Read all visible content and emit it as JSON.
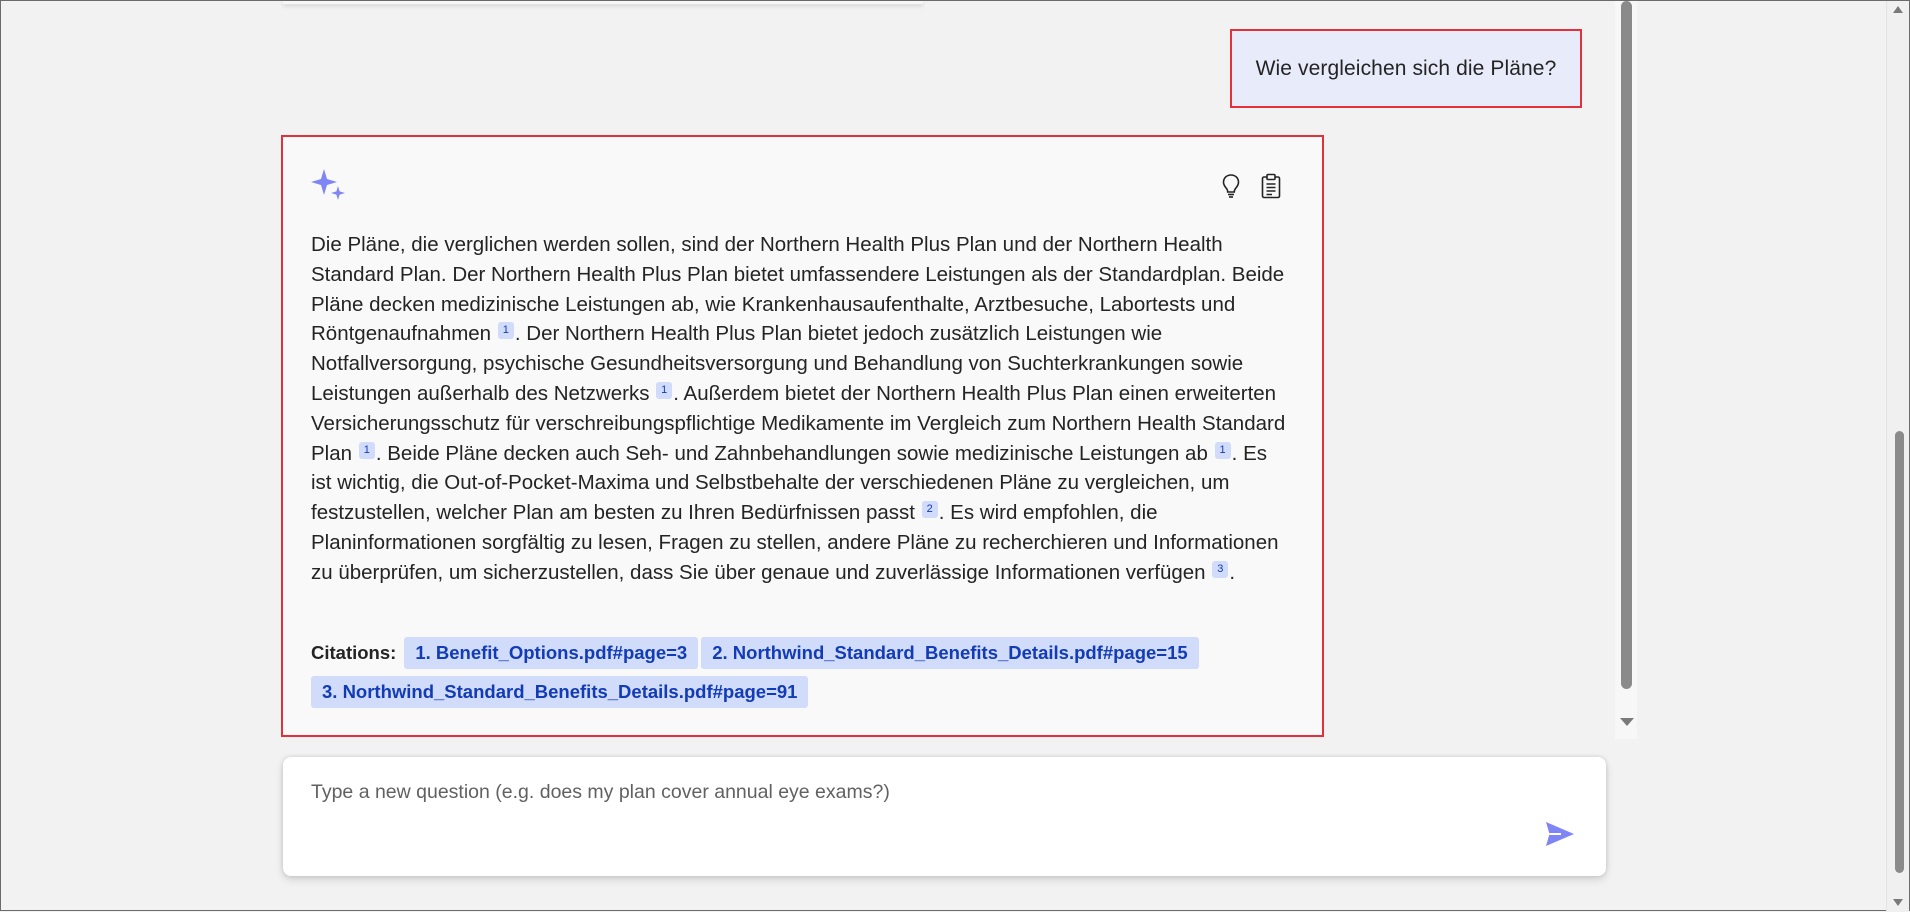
{
  "user_message": "Wie vergleichen sich die Pläne?",
  "answer": {
    "segments": [
      "Die Pläne, die verglichen werden sollen, sind der Northern Health Plus Plan und der Northern Health Standard Plan. Der Northern Health Plus Plan bietet umfassendere Leistungen als der Standardplan. Beide Pläne decken medizinische Leistungen ab, wie Krankenhausaufenthalte, Arztbesuche, Labortests und Röntgenaufnahmen ",
      ". Der Northern Health Plus Plan bietet jedoch zusätzlich Leistungen wie Notfallversorgung, psychische Gesundheitsversorgung und Behandlung von Suchterkrankungen sowie Leistungen außerhalb des Netzwerks ",
      ". Außerdem bietet der Northern Health Plus Plan einen erweiterten Versicherungsschutz für verschreibungspflichtige Medikamente im Vergleich zum Northern Health Standard Plan ",
      ". Beide Pläne decken auch Seh- und Zahnbehandlungen sowie medizinische Leistungen ab ",
      ". Es ist wichtig, die Out-of-Pocket-Maxima und Selbstbehalte der verschiedenen Pläne zu vergleichen, um festzustellen, welcher Plan am besten zu Ihren Bedürfnissen passt ",
      ". Es wird empfohlen, die Planinformationen sorgfältig zu lesen, Fragen zu stellen, andere Pläne zu recherchieren und Informationen zu überprüfen, um sicherzustellen, dass Sie über genaue und zuverlässige Informationen verfügen ",
      "."
    ],
    "refs": [
      "1",
      "1",
      "1",
      "1",
      "2",
      "3"
    ]
  },
  "citations": {
    "label": "Citations:",
    "items": [
      "1. Benefit_Options.pdf#page=3",
      "2. Northwind_Standard_Benefits_Details.pdf#page=15",
      "3. Northwind_Standard_Benefits_Details.pdf#page=91"
    ]
  },
  "input": {
    "placeholder": "Type a new question (e.g. does my plan cover annual eye exams?)",
    "value": ""
  },
  "colors": {
    "accent": "#7f85f5",
    "highlight_border": "#e3313b",
    "user_bubble": "#e8ebfa",
    "citation_bg": "#d1dbfa",
    "citation_text": "#123bb6"
  },
  "icons": {
    "answer": "sparkle-icon",
    "thought_process": "lightbulb-icon",
    "supporting_content": "clipboard-icon",
    "send": "send-icon"
  }
}
